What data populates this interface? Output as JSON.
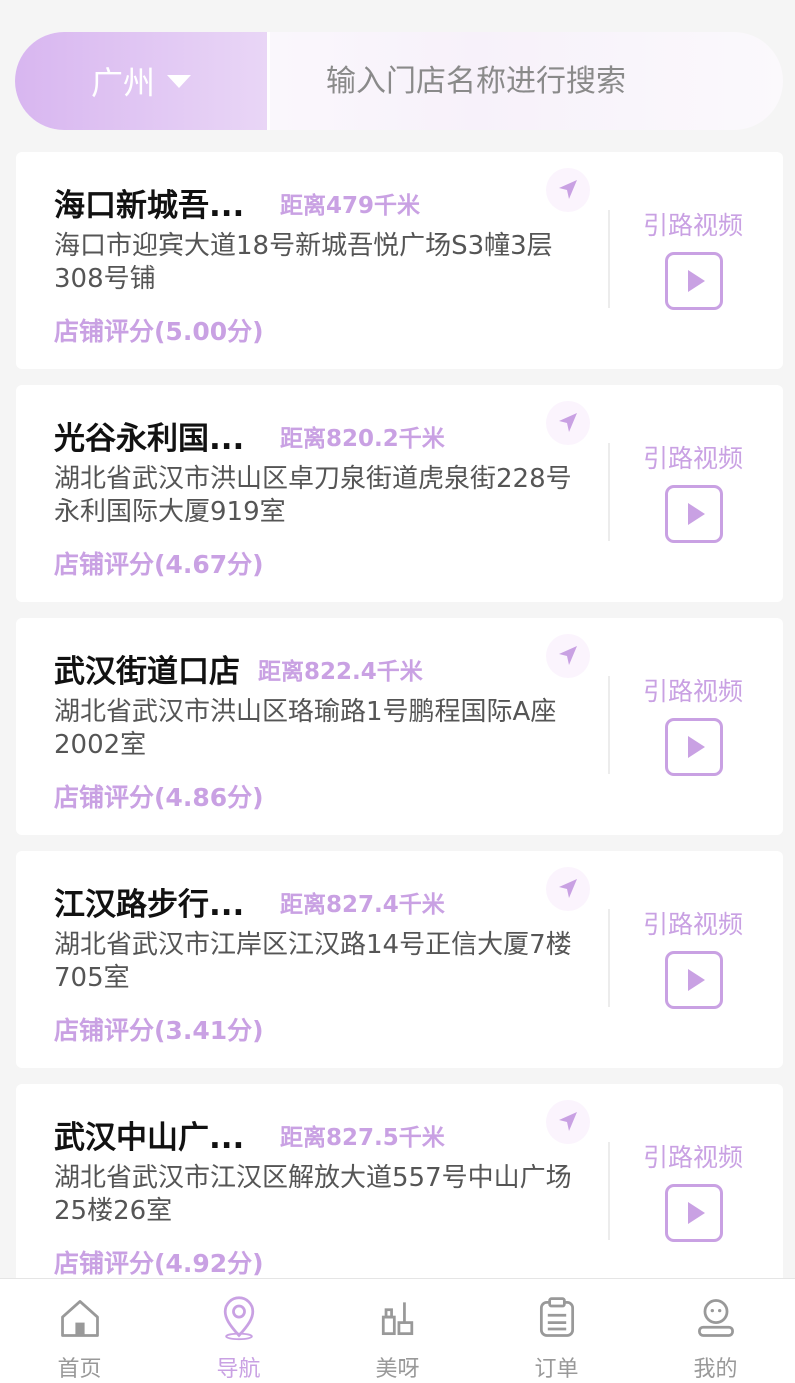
{
  "search": {
    "city": "广州",
    "placeholder": "输入门店名称进行搜索"
  },
  "colors": {
    "accent": "#c9a1e3",
    "city_gradient_start": "#d8b6f0",
    "text_dark": "#111111",
    "text_gray": "#555555"
  },
  "store_video_label": "引路视频",
  "stores": [
    {
      "name": "海口新城吾...",
      "distance": "距离479千米",
      "address": "海口市迎宾大道18号新城吾悦广场S3幢3层308号铺",
      "rating": "店铺评分(5.00分)"
    },
    {
      "name": "光谷永利国...",
      "distance": "距离820.2千米",
      "address": "湖北省武汉市洪山区卓刀泉街道虎泉街228号永利国际大厦919室",
      "rating": "店铺评分(4.67分)"
    },
    {
      "name": "武汉街道口店",
      "distance": "距离822.4千米",
      "address": "湖北省武汉市洪山区珞瑜路1号鹏程国际A座2002室",
      "rating": "店铺评分(4.86分)"
    },
    {
      "name": "江汉路步行...",
      "distance": "距离827.4千米",
      "address": "湖北省武汉市江岸区江汉路14号正信大厦7楼705室",
      "rating": "店铺评分(3.41分)"
    },
    {
      "name": "武汉中山广...",
      "distance": "距离827.5千米",
      "address": "湖北省武汉市江汉区解放大道557号中山广场25楼26室",
      "rating": "店铺评分(4.92分)"
    }
  ],
  "tabs": [
    {
      "label": "首页",
      "icon": "home-icon",
      "active": false
    },
    {
      "label": "导航",
      "icon": "location-pin-icon",
      "active": true
    },
    {
      "label": "美呀",
      "icon": "tools-icon",
      "active": false
    },
    {
      "label": "订单",
      "icon": "order-clipboard-icon",
      "active": false
    },
    {
      "label": "我的",
      "icon": "user-profile-icon",
      "active": false
    }
  ]
}
